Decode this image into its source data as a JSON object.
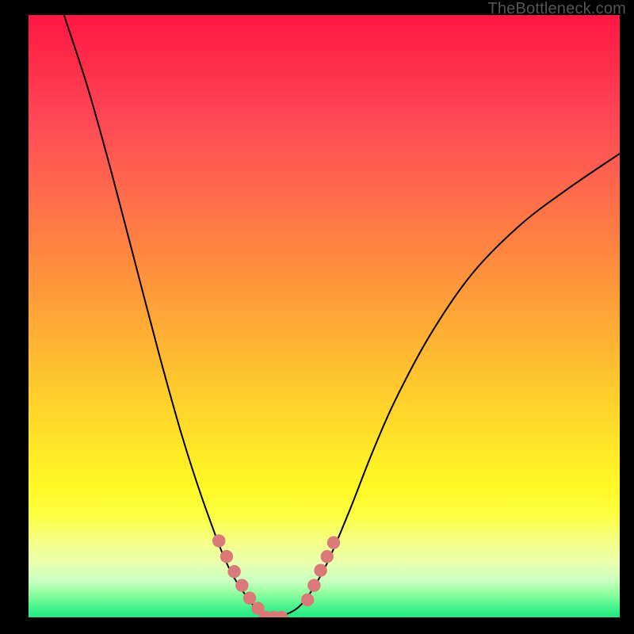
{
  "watermark": "TheBottleneck.com",
  "chart_data": {
    "type": "line",
    "title": "",
    "xlabel": "",
    "ylabel": "",
    "ylim": [
      0,
      100
    ],
    "series": [
      {
        "name": "curve",
        "x": [
          0.06,
          0.1,
          0.14,
          0.18,
          0.22,
          0.26,
          0.3,
          0.34,
          0.38,
          0.4,
          0.42,
          0.46,
          0.5,
          0.54,
          0.58,
          0.62,
          0.68,
          0.75,
          0.83,
          0.91,
          1.0
        ],
        "values": [
          100,
          88,
          74,
          59,
          44,
          30,
          18,
          8,
          2,
          0,
          0,
          2,
          8,
          17,
          27,
          36,
          47,
          57,
          65,
          71,
          77
        ]
      }
    ],
    "markers": [
      {
        "x": 0.322,
        "y": 12.7
      },
      {
        "x": 0.335,
        "y": 10.1
      },
      {
        "x": 0.348,
        "y": 7.6
      },
      {
        "x": 0.361,
        "y": 5.3
      },
      {
        "x": 0.374,
        "y": 3.2
      },
      {
        "x": 0.388,
        "y": 1.5
      },
      {
        "x": 0.401,
        "y": 0
      },
      {
        "x": 0.415,
        "y": 0
      },
      {
        "x": 0.428,
        "y": 0
      },
      {
        "x": 0.472,
        "y": 2.9
      },
      {
        "x": 0.483,
        "y": 5.3
      },
      {
        "x": 0.494,
        "y": 7.8
      },
      {
        "x": 0.505,
        "y": 10.1
      },
      {
        "x": 0.516,
        "y": 12.4
      }
    ],
    "background": {
      "type": "vertical-gradient",
      "stops": [
        {
          "pct": 0,
          "color": "#ff1744"
        },
        {
          "pct": 50,
          "color": "#ffb030"
        },
        {
          "pct": 82,
          "color": "#fff825"
        },
        {
          "pct": 100,
          "color": "#20e884"
        }
      ]
    }
  }
}
